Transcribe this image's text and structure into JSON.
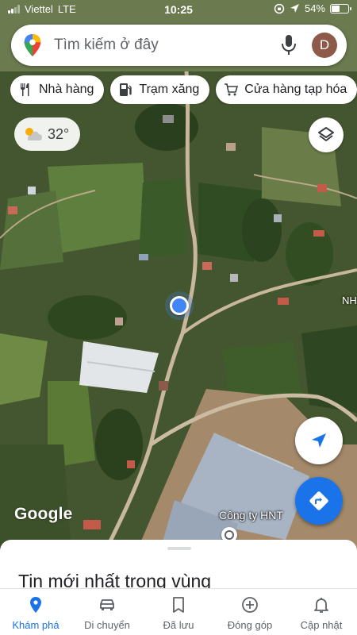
{
  "status_bar": {
    "carrier": "Viettel",
    "network": "LTE",
    "time": "10:25",
    "battery_percent": 54,
    "battery_label": "54%"
  },
  "search": {
    "placeholder": "Tìm kiếm ở đây",
    "avatar_initial": "D",
    "icons": [
      "maps-pin-icon",
      "mic-icon"
    ]
  },
  "chips": [
    {
      "label": "Nhà hàng",
      "icon": "restaurant-icon"
    },
    {
      "label": "Trạm xăng",
      "icon": "gas-station-icon"
    },
    {
      "label": "Cửa hàng tạp hóa",
      "icon": "cart-icon"
    }
  ],
  "weather": {
    "temperature": "32°",
    "icon": "partly-cloudy-icon"
  },
  "map": {
    "logo": "Google",
    "poi_label": "Công ty HNT",
    "edge_label": "NH"
  },
  "sheet": {
    "title": "Tin mới nhất trong vùng"
  },
  "nav": [
    {
      "label": "Khám phá",
      "icon": "explore-pin-icon",
      "active": true
    },
    {
      "label": "Di chuyển",
      "icon": "car-icon",
      "active": false
    },
    {
      "label": "Đã lưu",
      "icon": "bookmark-icon",
      "active": false
    },
    {
      "label": "Đóng góp",
      "icon": "add-circle-icon",
      "active": false
    },
    {
      "label": "Cập nhật",
      "icon": "bell-icon",
      "active": false
    }
  ],
  "colors": {
    "accent": "#1a73e8",
    "location_dot": "#4285f4",
    "inactive_nav": "#5f6368"
  }
}
